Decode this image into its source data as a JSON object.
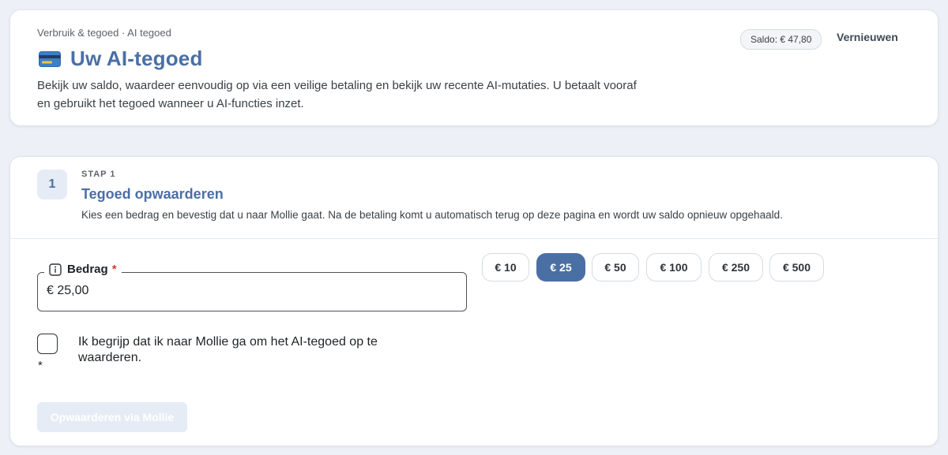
{
  "header": {
    "breadcrumb": "Verbruik & tegoed · AI tegoed",
    "title": "Uw AI-tegoed",
    "intro": "Bekijk uw saldo, waardeer eenvoudig op via een veilige betaling en bekijk uw recente AI-mutaties. U betaalt vooraf en gebruikt het tegoed wanneer u AI-functies inzet.",
    "balance_badge": "Saldo: € 47,80",
    "refresh_label": "Vernieuwen",
    "icon": "credit-card-icon"
  },
  "step": {
    "number": "1",
    "kicker": "STAP 1",
    "title": "Tegoed opwaarderen",
    "description": "Kies een bedrag en bevestig dat u naar Mollie gaat. Na de betaling komt u automatisch terug op deze pagina en wordt uw saldo opnieuw opgehaald."
  },
  "amount": {
    "label": "Bedrag",
    "required_mark": "*",
    "value": "€ 25,00",
    "info_icon": "info-icon"
  },
  "presets": [
    {
      "label": "€ 10",
      "selected": false
    },
    {
      "label": "€ 25",
      "selected": true
    },
    {
      "label": "€ 50",
      "selected": false
    },
    {
      "label": "€ 100",
      "selected": false
    },
    {
      "label": "€ 250",
      "selected": false
    },
    {
      "label": "€ 500",
      "selected": false
    }
  ],
  "consent": {
    "label": "Ik begrijp dat ik naar Mollie ga om het AI-tegoed op te waarderen.",
    "required_mark": "*",
    "checked": false
  },
  "submit": {
    "label": "Opwaarderen via Mollie",
    "disabled": true
  },
  "colors": {
    "accent": "#4a6fa5",
    "background": "#edf1f7",
    "required": "#d33a3a",
    "disabled_button": "#e6ecf5"
  }
}
